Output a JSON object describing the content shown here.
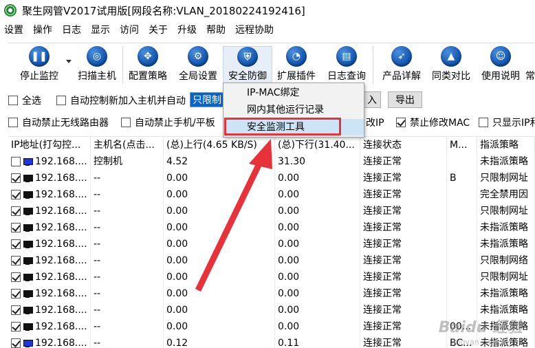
{
  "title": "聚生网管V2017试用版[网段名称:VLAN_20180224192416]",
  "menu": [
    "设置",
    "操作",
    "日志",
    "显示",
    "访问",
    "关于",
    "升级",
    "帮助",
    "远程协助"
  ],
  "toolbar": {
    "stop_monitor": "停止监控",
    "scan_host": "扫描主机",
    "config_policy": "配置策略",
    "global_settings": "全局设置",
    "security_defense": "安全防御",
    "extensions": "扩展插件",
    "log_query": "日志查询",
    "product_details": "产品详解",
    "compare": "同类对比",
    "manual": "使用说明",
    "more": "常"
  },
  "options": {
    "select_all": "全选",
    "auto_control": "自动控制新加入主机并自动",
    "combo_value": "只限制",
    "import_btn": "入",
    "export_btn": "导出",
    "ban_wireless": "自动禁止无线路由器",
    "ban_phone": "自动禁止手机/平板",
    "ban_ip_tail": "改IP",
    "ban_mac": "禁止修改MAC",
    "show_ip": "只显示IP和"
  },
  "dropdown": {
    "items": [
      "IP-MAC绑定",
      "网内其他运行记录",
      "安全监测工具"
    ]
  },
  "table": {
    "headers": [
      "IP地址(打勾控...",
      "主机名(点击...",
      "(总)上行(4.65 KB/S)",
      "(总)下行(31.40...",
      "连接状态",
      "M...",
      "指派策略"
    ],
    "rows": [
      {
        "checked": false,
        "blue": true,
        "ip": "192.168....",
        "host": "控制机",
        "up": "4.52",
        "down": "31.30",
        "status": "连接正常",
        "mac": "",
        "policy": "未指派策略"
      },
      {
        "checked": true,
        "blue": false,
        "ip": "192.168....",
        "host": "--",
        "up": "0.00",
        "down": "0.00",
        "status": "连接正常",
        "mac": "B",
        "policy": "只限制网址"
      },
      {
        "checked": true,
        "blue": false,
        "ip": "192.168....",
        "host": "--",
        "up": "0.00",
        "down": "0.00",
        "status": "连接正常",
        "mac": "",
        "policy": "完全禁用因"
      },
      {
        "checked": true,
        "blue": false,
        "ip": "192.168....",
        "host": "--",
        "up": "0.00",
        "down": "0.00",
        "status": "连接正常",
        "mac": "",
        "policy": "只限制网址"
      },
      {
        "checked": true,
        "blue": false,
        "ip": "192.168....",
        "host": "--",
        "up": "0.00",
        "down": "0.00",
        "status": "连接正常",
        "mac": "",
        "policy": "未指派策略"
      },
      {
        "checked": true,
        "blue": false,
        "ip": "192.168....",
        "host": "--",
        "up": "0.00",
        "down": "0.00",
        "status": "连接正常",
        "mac": "",
        "policy": "未指派策略"
      },
      {
        "checked": true,
        "blue": false,
        "ip": "192.168....",
        "host": "--",
        "up": "0.00",
        "down": "0.00",
        "status": "连接正常",
        "mac": "",
        "policy": "只限制网络"
      },
      {
        "checked": true,
        "blue": false,
        "ip": "192.168....",
        "host": "--",
        "up": "0.00",
        "down": "0.00",
        "status": "连接正常",
        "mac": "",
        "policy": "只限制网址"
      },
      {
        "checked": true,
        "blue": false,
        "ip": "192.168....",
        "host": "--",
        "up": "0.00",
        "down": "0.00",
        "status": "连接正常",
        "mac": "",
        "policy": "未指派策略"
      },
      {
        "checked": true,
        "blue": false,
        "ip": "192.168....",
        "host": "--",
        "up": "0.00",
        "down": "0.00",
        "status": "连接正常",
        "mac": "",
        "policy": "未指派策略"
      },
      {
        "checked": true,
        "blue": false,
        "ip": "192.168....",
        "host": "--",
        "up": "0.00",
        "down": "0.00",
        "status": "连接正常",
        "mac": "00...",
        "policy": "未指派策略"
      },
      {
        "checked": true,
        "blue": true,
        "ip": "192.168....",
        "host": "--",
        "up": "0.12",
        "down": "0.11",
        "status": "连接正常",
        "mac": "BC...",
        "policy": "未指派策略"
      }
    ]
  },
  "watermark": {
    "brand": "Baidu 经验",
    "url": "jingyan.baidu.com"
  },
  "colors": {
    "highlight": "#e8323a",
    "accent": "#0a64c8",
    "arrow": "#e8323a"
  }
}
